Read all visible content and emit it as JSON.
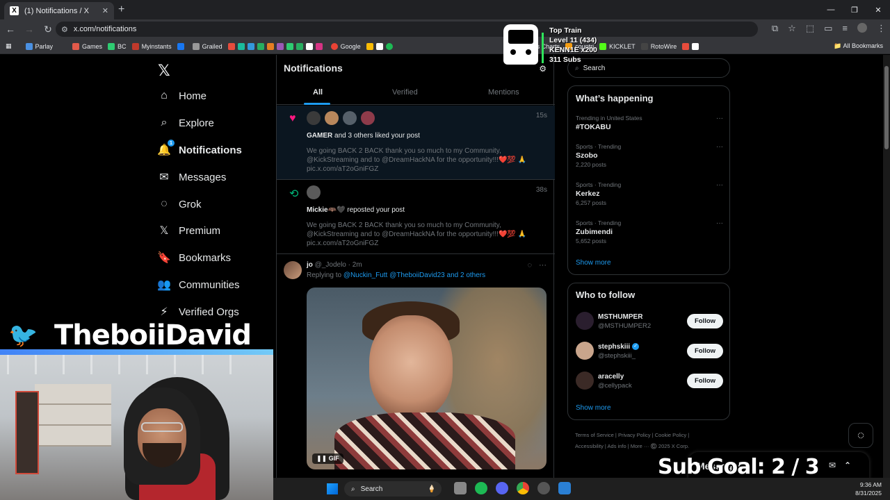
{
  "browser": {
    "tab_title": "(1) Notifications / X",
    "tab_favicon": "X",
    "url": "x.com/notifications",
    "bookmarks": [
      "Parlay",
      "Games",
      "BC",
      "Myinstants",
      "Grailed",
      "Google",
      "Streams Charts",
      "countri",
      "KICKLET",
      "RotoWire"
    ],
    "all_bookmarks": "All Bookmarks"
  },
  "nav": {
    "logo": "𝕏",
    "items": [
      {
        "label": "Home",
        "icon": "⌂"
      },
      {
        "label": "Explore",
        "icon": "⌕"
      },
      {
        "label": "Notifications",
        "icon": "🔔",
        "badge": "1"
      },
      {
        "label": "Messages",
        "icon": "✉"
      },
      {
        "label": "Grok",
        "icon": "◌"
      },
      {
        "label": "Premium",
        "icon": "𝕏"
      },
      {
        "label": "Bookmarks",
        "icon": "🔖"
      },
      {
        "label": "Communities",
        "icon": "👥"
      },
      {
        "label": "Verified Orgs",
        "icon": "⚡"
      }
    ]
  },
  "timeline": {
    "title": "Notifications",
    "tabs": [
      "All",
      "Verified",
      "Mentions"
    ],
    "notifications": [
      {
        "user": "GAMER",
        "action": " and 3 others liked your post",
        "time": "15s",
        "body": "We going BACK 2 BACK thank you so much to my Community, @KickStreaming and to @DreamHackNA  for the opportunity!!!❤️💯 🙏 pic.x.com/aT2oGniFGZ"
      },
      {
        "user": "Mickie🦇🖤",
        "action": " reposted your post",
        "time": "38s",
        "body": "We going BACK 2 BACK thank you so much to my Community, @KickStreaming and to @DreamHackNA  for the opportunity!!!❤️💯 🙏 pic.x.com/aT2oGniFGZ"
      }
    ],
    "tweet": {
      "name": "jo",
      "handle": "@_Jodelo · 2m",
      "replying_prefix": "Replying to ",
      "replying_to": "@Nuckin_Futt @TheboiiDavid23 and 2 others",
      "gif_label": "GIF"
    }
  },
  "sidebar": {
    "search_placeholder": "Search",
    "happening_title": "What’s happening",
    "trends": [
      {
        "meta": "Trending in United States",
        "name": "#TOKABU",
        "count": ""
      },
      {
        "meta": "Sports · Trending",
        "name": "Szobo",
        "count": "2,220 posts"
      },
      {
        "meta": "Sports · Trending",
        "name": "Kerkez",
        "count": "6,257 posts"
      },
      {
        "meta": "Sports · Trending",
        "name": "Zubimendi",
        "count": "5,652 posts"
      }
    ],
    "show_more": "Show more",
    "follow_title": "Who to follow",
    "follows": [
      {
        "name": "MSTHUMPER",
        "handle": "@MSTHUMPER2",
        "verified": false
      },
      {
        "name": "stephskiii",
        "handle": "@stephskiii_",
        "verified": true
      },
      {
        "name": "aracelly",
        "handle": "@cellypack",
        "verified": false
      }
    ],
    "follow_label": "Follow",
    "footer_line1": "Terms of Service  |  Privacy Policy  |  Cookie Policy  |",
    "footer_line2": "Accessibility  |  Ads info  |  More ···  ©️ 2025 X Corp.",
    "messages_label": "Messages"
  },
  "overlay": {
    "brand_name": "TheboiiDavid",
    "train_title": "Top Train",
    "train_level": "Level 11  (434)",
    "train_user": "KENN1E x200",
    "train_subs": "311 Subs",
    "sub_goal": "Sub Goal:  2 / 3"
  },
  "taskbar": {
    "search": "Search",
    "time": "9:36 AM",
    "date": "8/31/2025"
  },
  "colors": {
    "accent": "#1d9bf0",
    "like": "#f91880",
    "repost": "#00ba7c"
  }
}
